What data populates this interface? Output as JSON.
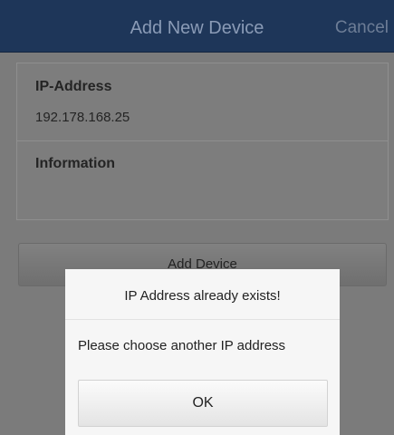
{
  "header": {
    "title": "Add New Device",
    "cancel_label": "Cancel"
  },
  "form": {
    "ip_label": "IP-Address",
    "ip_value": "192.178.168.25",
    "info_label": "Information",
    "info_value": ""
  },
  "add_button_label": "Add Device",
  "dialog": {
    "title": "IP Address already exists!",
    "message": "Please choose another IP address",
    "ok_label": "OK"
  }
}
